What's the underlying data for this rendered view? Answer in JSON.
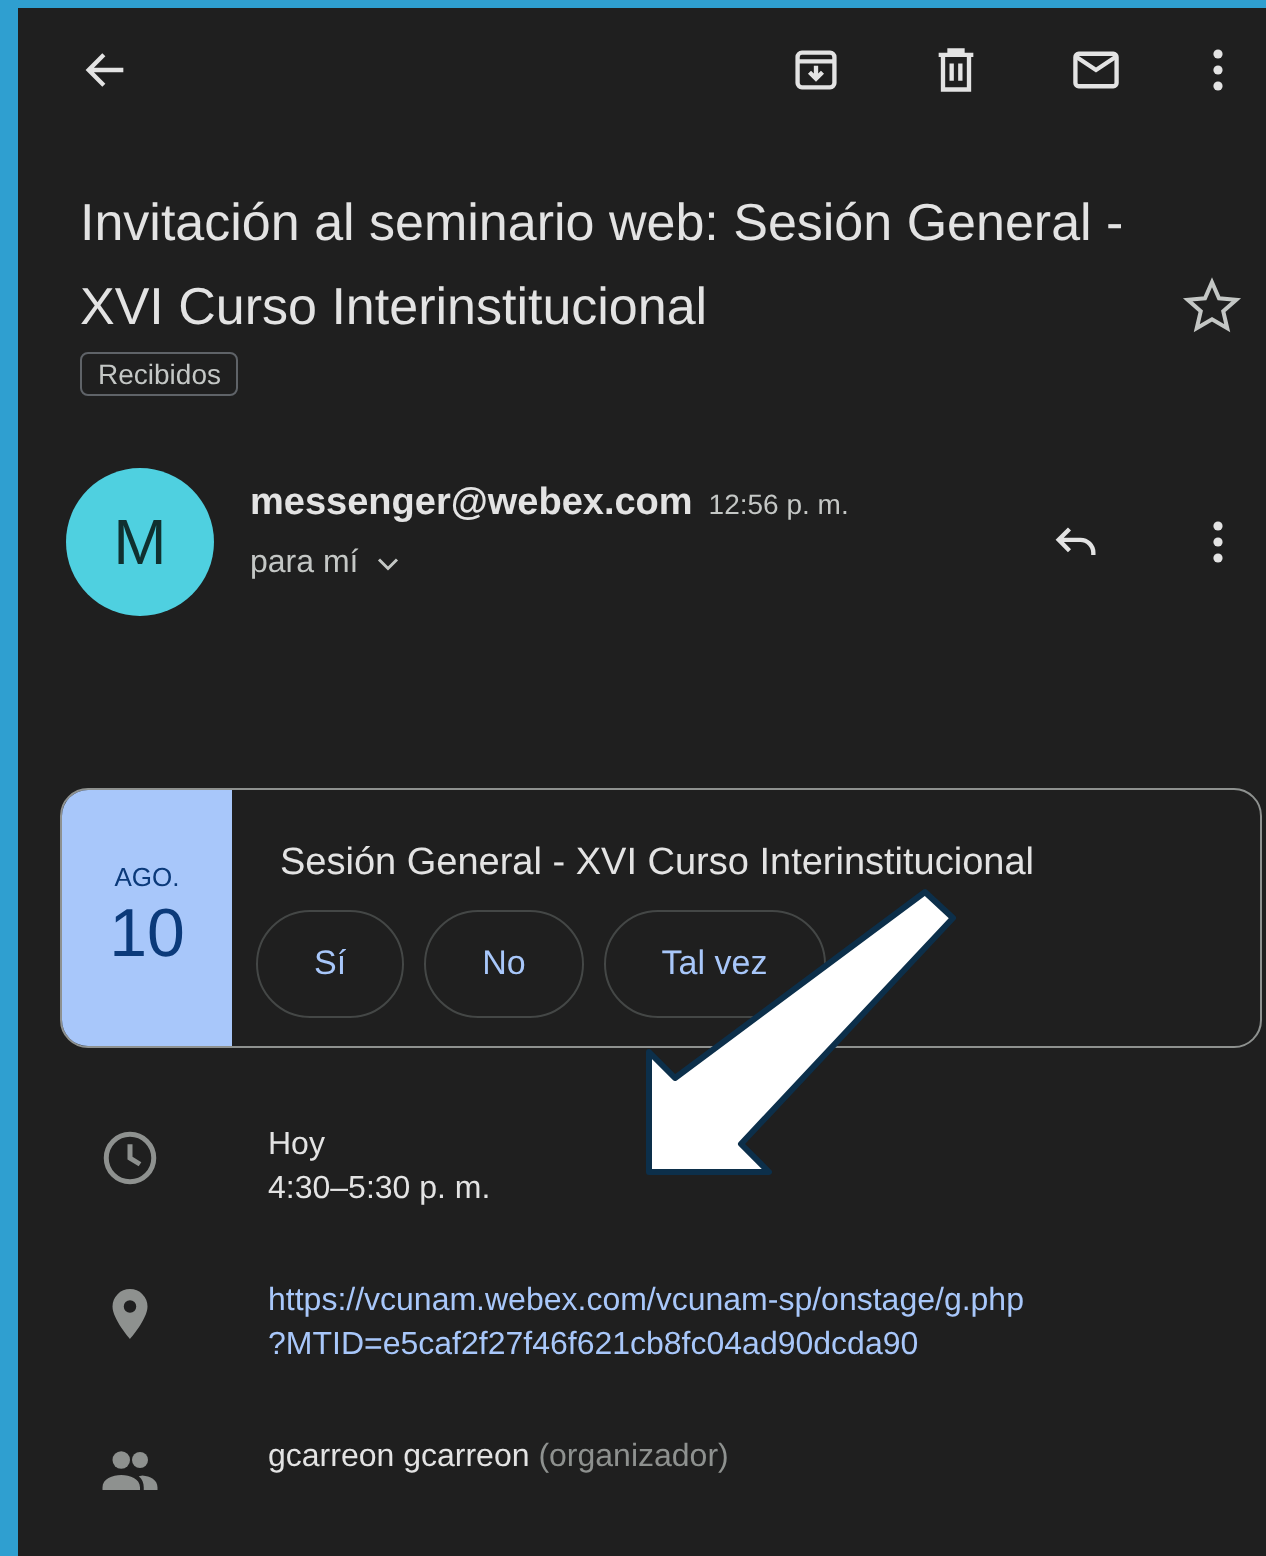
{
  "email": {
    "subject": "Invitación al seminario web: Sesión General - XVI Curso Interinstitucional",
    "starred": false,
    "label": "Recibidos",
    "sender": {
      "avatar": "M",
      "address": "messenger@webex.com",
      "time": "12:56 p. m.",
      "recipient": "para mí"
    }
  },
  "event": {
    "month": "AGO.",
    "day": "10",
    "title": "Sesión General - XVI Curso Interinstitucional",
    "rsvp": [
      {
        "label": "Sí"
      },
      {
        "label": "No"
      },
      {
        "label": "Tal vez"
      }
    ]
  },
  "details": [
    {
      "kind": "time",
      "lines": [
        "Hoy",
        "4:30–5:30 p. m."
      ]
    },
    {
      "kind": "location",
      "lines": [
        "https://vcunam.webex.com/vcunam-sp/onstage/g.php",
        "?MTID=e5caf2f27f46f621cb8fc04ad90dcda90"
      ]
    },
    {
      "kind": "organizer",
      "name": "gcarreon gcarreon",
      "role": "(organizador)"
    }
  ]
}
